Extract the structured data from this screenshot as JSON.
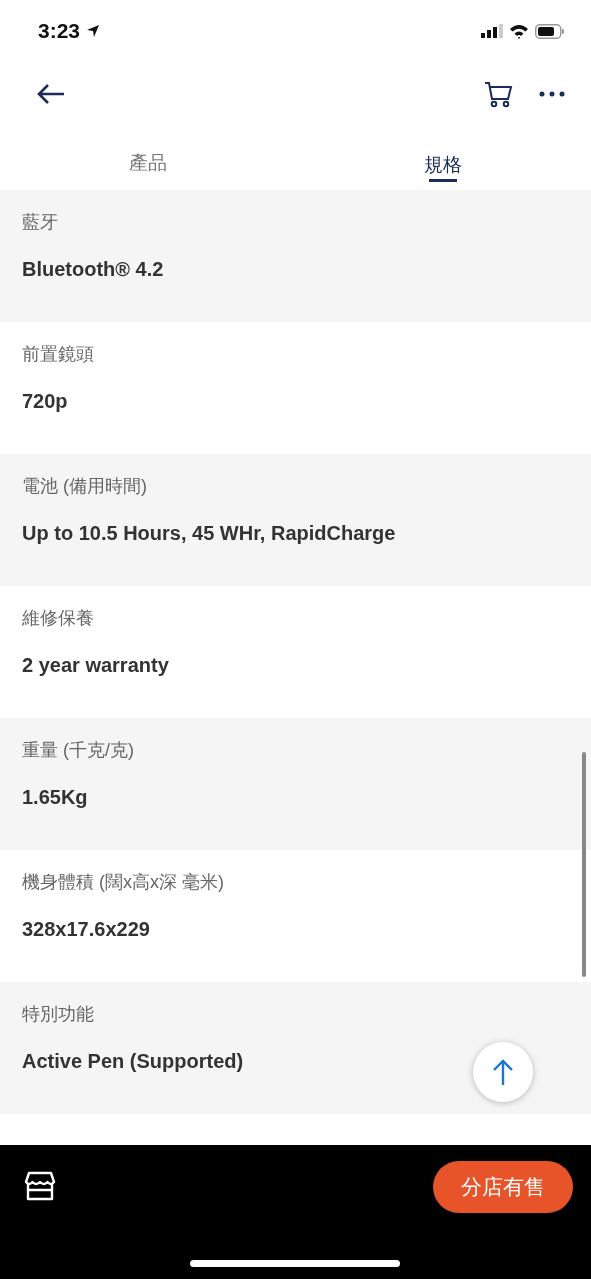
{
  "status_bar": {
    "time": "3:23"
  },
  "tabs": [
    {
      "label": "產品",
      "selected": false
    },
    {
      "label": "規格",
      "selected": true
    }
  ],
  "specs": [
    {
      "label": "藍牙",
      "value": "Bluetooth® 4.2"
    },
    {
      "label": "前置鏡頭",
      "value": "720p"
    },
    {
      "label": "電池 (備用時間)",
      "value": "Up to 10.5 Hours, 45 WHr, RapidCharge"
    },
    {
      "label": "維修保養",
      "value": "2 year warranty"
    },
    {
      "label": "重量 (千克/克)",
      "value": "1.65Kg"
    },
    {
      "label": "機身體積 (闊x高x深 毫米)",
      "value": "328x17.6x229"
    },
    {
      "label": "特別功能",
      "value": "Active Pen (Supported)"
    }
  ],
  "bottom_bar": {
    "button": "分店有售"
  }
}
